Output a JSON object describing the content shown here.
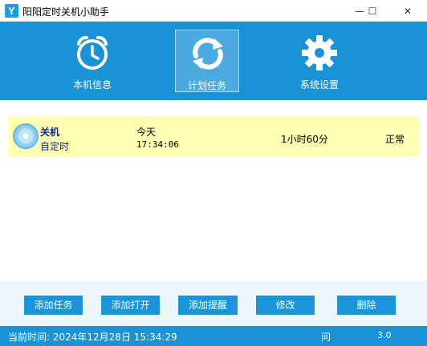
{
  "window": {
    "title": "阳阳定时关机小助手",
    "icon_letter": "Y",
    "minimize_glyph": "—",
    "maximize_glyph": "☐",
    "close_glyph": "✕"
  },
  "toolbar": {
    "items": [
      {
        "label": "本机信息",
        "icon": "alarm-clock-icon",
        "active": false
      },
      {
        "label": "计划任务",
        "icon": "refresh-arrows-icon",
        "active": true
      },
      {
        "label": "系统设置",
        "icon": "gear-icon",
        "active": false
      }
    ]
  },
  "tasks": [
    {
      "action": "关机",
      "type": "自定时",
      "day": "今天",
      "time": "17:34:06",
      "interval": "1小时60分",
      "status": "正常",
      "icon": "disc-icon",
      "highlight_color": "#ffffb4"
    }
  ],
  "buttons": {
    "add_task": "添加任务",
    "add_open": "添加打开",
    "add_reminder": "添加提醒",
    "edit": "修改",
    "delete": "删除"
  },
  "statusbar": {
    "current_time": "当前时间: 2024年12月28日 15:34:29",
    "help": "问",
    "version": "3.0"
  },
  "colors": {
    "accent": "#1993d6",
    "button": "#1b95d8",
    "button_bar": "#ecf6fb"
  }
}
